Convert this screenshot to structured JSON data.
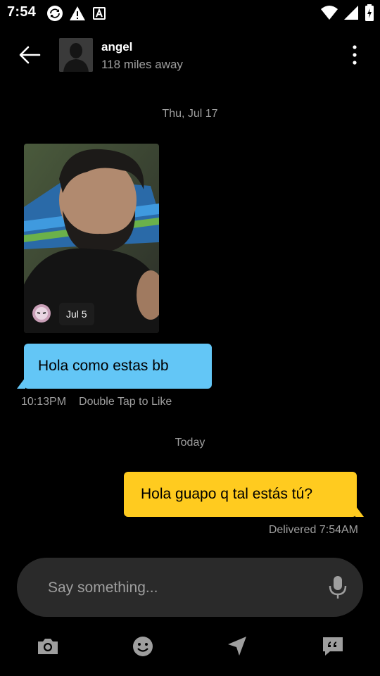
{
  "status_bar": {
    "time": "7:54",
    "left_icons": [
      "sync-icon",
      "warning-icon",
      "font-a-icon"
    ],
    "right_icons": [
      "wifi-icon",
      "signal-icon",
      "battery-icon"
    ]
  },
  "header": {
    "name": "angel",
    "distance": "118 miles away"
  },
  "conversation": {
    "date_1": "Thu, Jul 17",
    "photo_badge": "Jul 5",
    "incoming_text": "Hola como estas bb",
    "incoming_time": "10:13PM",
    "incoming_hint": "Double Tap to Like",
    "date_2": "Today",
    "outgoing_text": "Hola guapo q tal estás tú?",
    "outgoing_status": "Delivered 7:54AM"
  },
  "composer": {
    "placeholder": "Say something..."
  },
  "colors": {
    "incoming_bubble": "#63c6f6",
    "outgoing_bubble": "#ffcb1f",
    "background": "#000000"
  }
}
